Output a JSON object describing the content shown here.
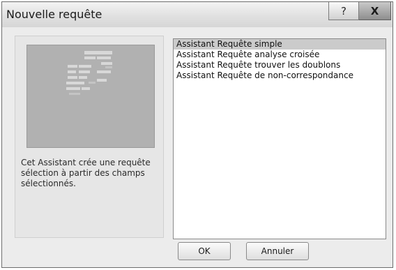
{
  "window": {
    "title": "Nouvelle requête",
    "help_label": "?",
    "close_label": "X"
  },
  "description": "Cet Assistant crée une requête sélection à partir des champs sélectionnés.",
  "wizards": [
    "Assistant Requête simple",
    "Assistant Requête analyse croisée",
    "Assistant Requête trouver les doublons",
    "Assistant Requête de non-correspondance"
  ],
  "selected_index": 0,
  "buttons": {
    "ok": "OK",
    "cancel": "Annuler"
  }
}
